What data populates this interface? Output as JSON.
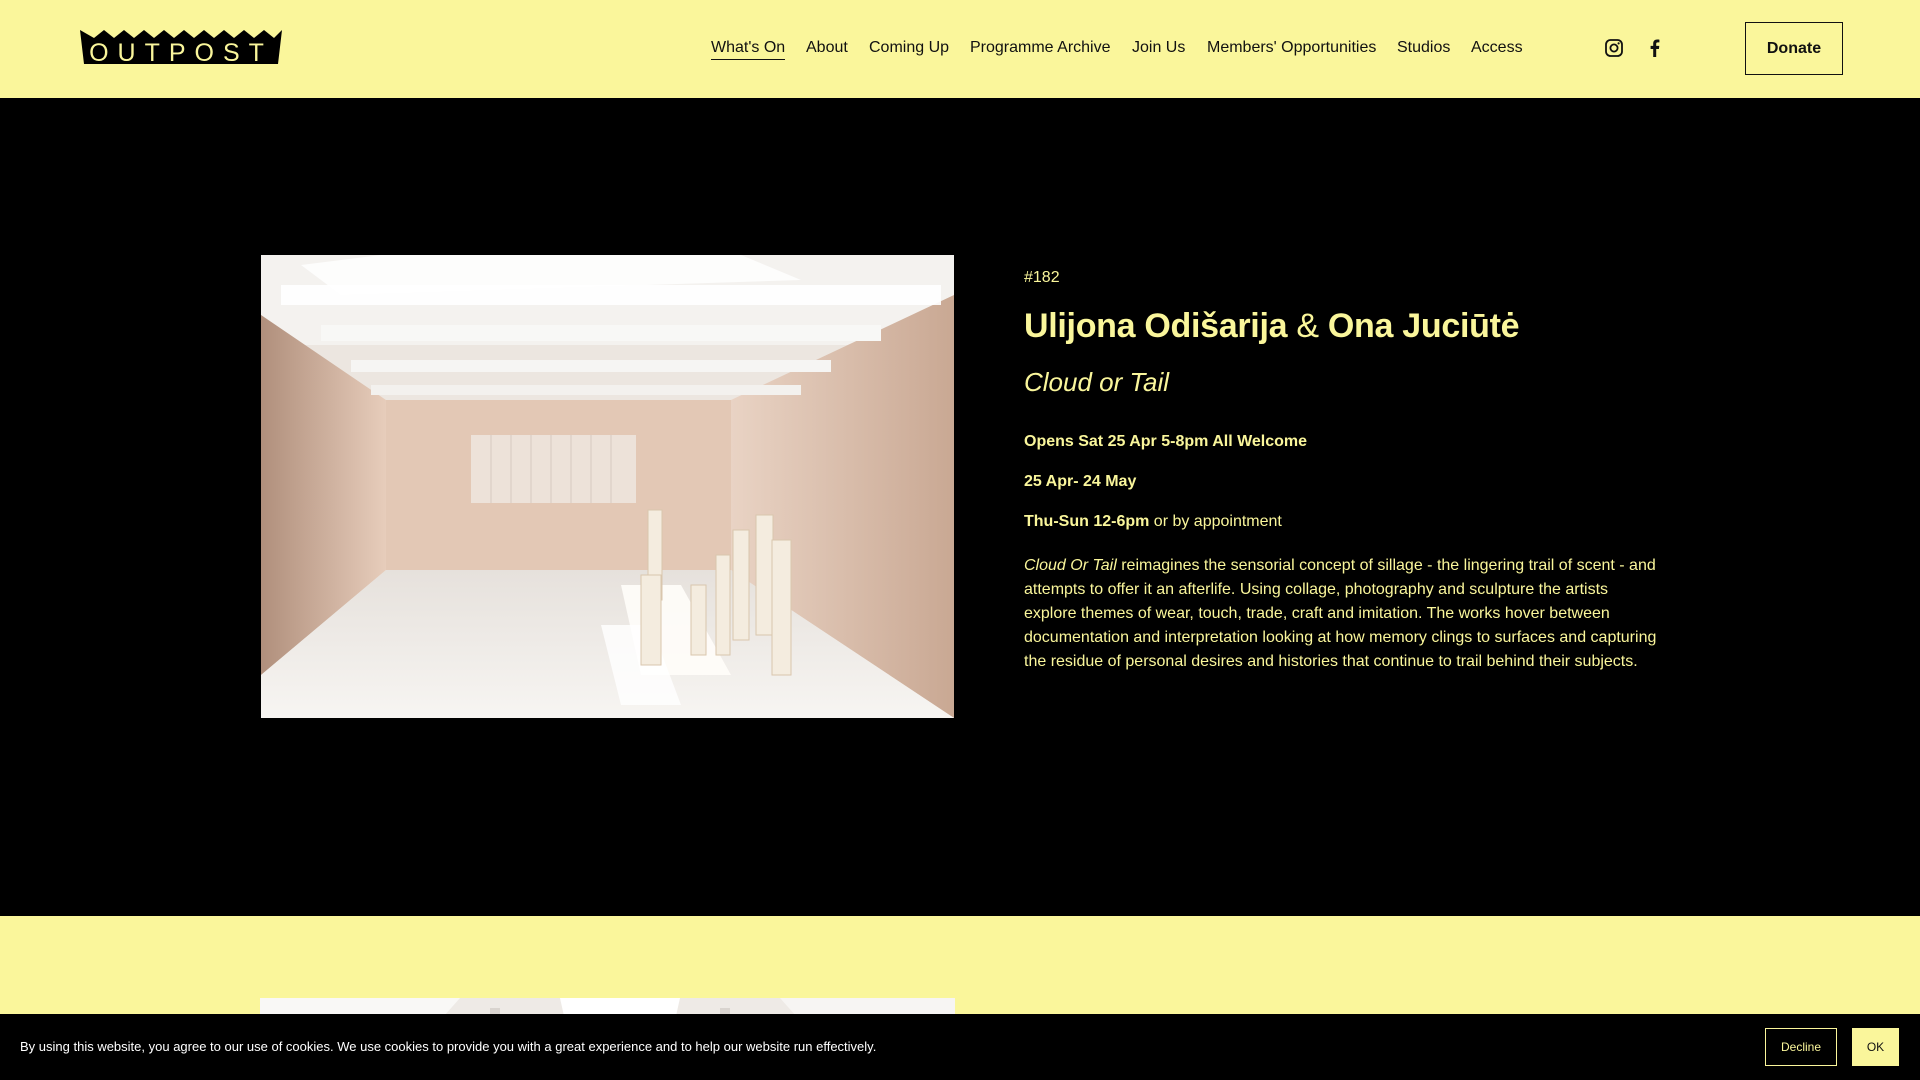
{
  "brand": {
    "logo_text": "OUTPOST"
  },
  "nav": {
    "items": [
      {
        "label": "What's On",
        "active": true
      },
      {
        "label": "About"
      },
      {
        "label": "Coming Up"
      },
      {
        "label": "Programme Archive"
      },
      {
        "label": "Join Us"
      },
      {
        "label": "Members' Opportunities"
      },
      {
        "label": "Studios"
      },
      {
        "label": "Access"
      }
    ],
    "social": [
      "instagram-icon",
      "facebook-icon"
    ],
    "donate_label": "Donate"
  },
  "exhibition": {
    "number": "#182",
    "artist_1": "Ulijona Odišarija",
    "amp": "&",
    "artist_2": "Ona Juciūtė",
    "title": "Cloud or Tail",
    "opening": "Opens Sat 25 Apr 5-8pm  All Welcome",
    "dates": "25 Apr- 24 May",
    "hours_bold": "Thu-Sun 12-6pm",
    "hours_rest": " or by appointment",
    "desc_italic": "Cloud Or Tail",
    "desc_rest": " reimagines the sensorial concept of sillage - the lingering trail of scent - and attempts to offer it an afterlife. Using collage, photography and sculpture the artists explore themes of wear, touch, trade, craft and imitation. The works hover between documentation and interpretation looking at how memory clings to surfaces and capturing the residue of personal desires and histories that continue to trail behind their subjects."
  },
  "cookie": {
    "text": "By using this website, you agree to our use of cookies. We use cookies to provide you with a great experience and to help our website run effectively.",
    "decline_label": "Decline",
    "ok_label": "OK"
  },
  "colors": {
    "accent": "#faf69b",
    "background": "#000000"
  }
}
